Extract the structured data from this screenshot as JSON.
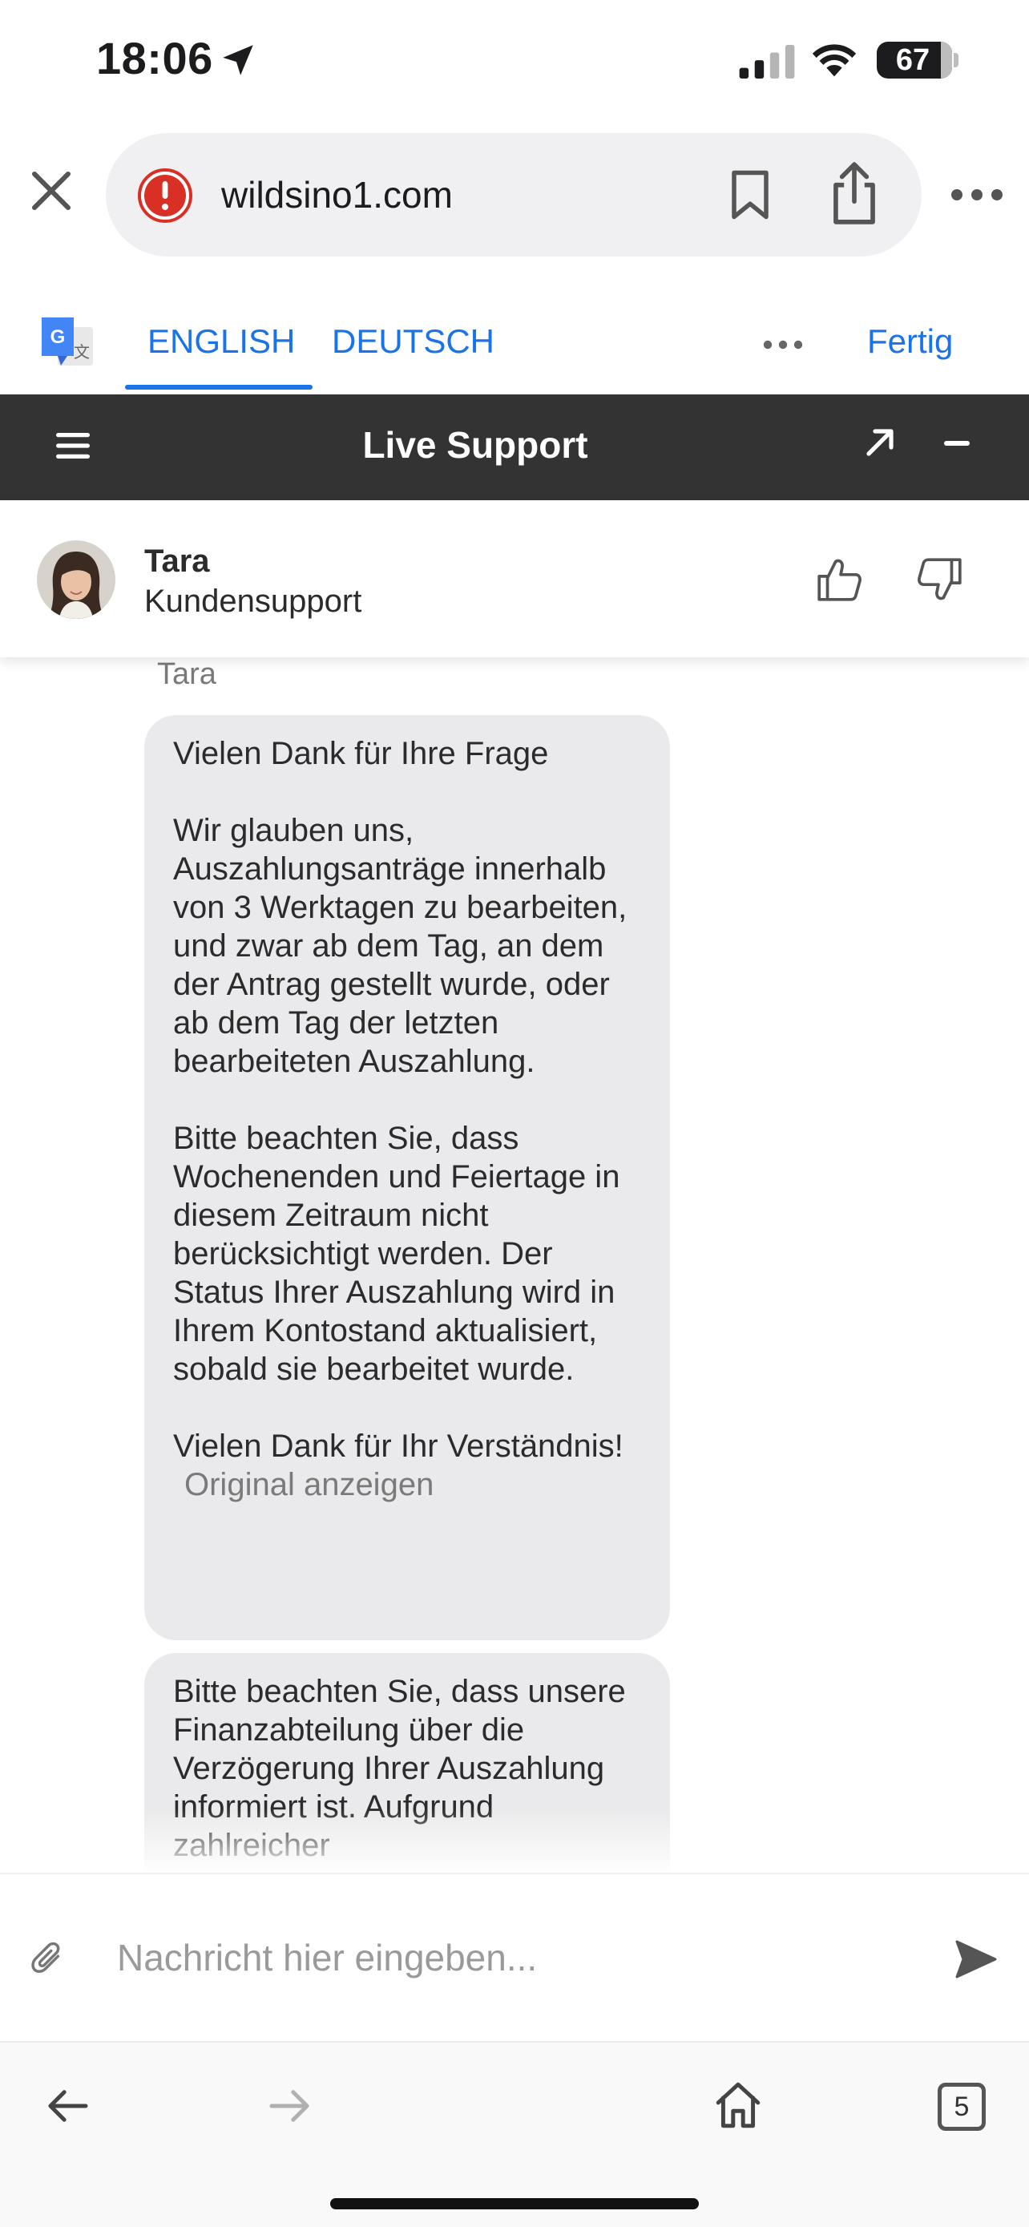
{
  "status_bar": {
    "time": "18:06",
    "battery": "67",
    "icons": [
      "location-arrow-icon",
      "cellular-signal-icon",
      "wifi-icon",
      "battery-icon"
    ]
  },
  "browser": {
    "url": "wildsino1.com",
    "icons": [
      "close-icon",
      "warning-icon",
      "bookmark-icon",
      "share-icon",
      "more-icon"
    ]
  },
  "translate_bar": {
    "tabs": [
      {
        "label": "ENGLISH",
        "active": true
      },
      {
        "label": "DEUTSCH",
        "active": false
      }
    ],
    "done_label": "Fertig",
    "accent_color": "#1a73e8"
  },
  "live_support": {
    "title": "Live Support",
    "header_color": "#333333"
  },
  "agent": {
    "name": "Tara",
    "role": "Kundensupport"
  },
  "conversation": {
    "sender": "Tara",
    "messages": [
      {
        "text": "Vielen Dank für Ihre Frage\n\nWir glauben uns, Auszahlungsanträge innerhalb von 3 Werktagen zu bearbeiten, und zwar ab dem Tag, an dem der Antrag gestellt wurde, oder ab dem Tag der letzten bearbeiteten Auszahlung.\n\nBitte beachten Sie, dass Wochenenden und Feiertage in diesem Zeitraum nicht berücksichtigt werden. Der Status Ihrer Auszahlung wird in Ihrem Kontostand aktualisiert, sobald sie bearbeitet wurde.\n\nVielen Dank für Ihr Verständnis!",
        "original_link": "Original anzeigen"
      },
      {
        "text": "Bitte beachten Sie, dass unsere Finanzabteilung über die Verzögerung Ihrer Auszahlung informiert ist. Aufgrund zahlreicher"
      }
    ]
  },
  "composer": {
    "placeholder": "Nachricht hier eingeben..."
  },
  "toolbar": {
    "tab_count": "5",
    "icons": [
      "back-arrow-icon",
      "forward-arrow-icon",
      "home-icon",
      "tabs-icon"
    ]
  }
}
